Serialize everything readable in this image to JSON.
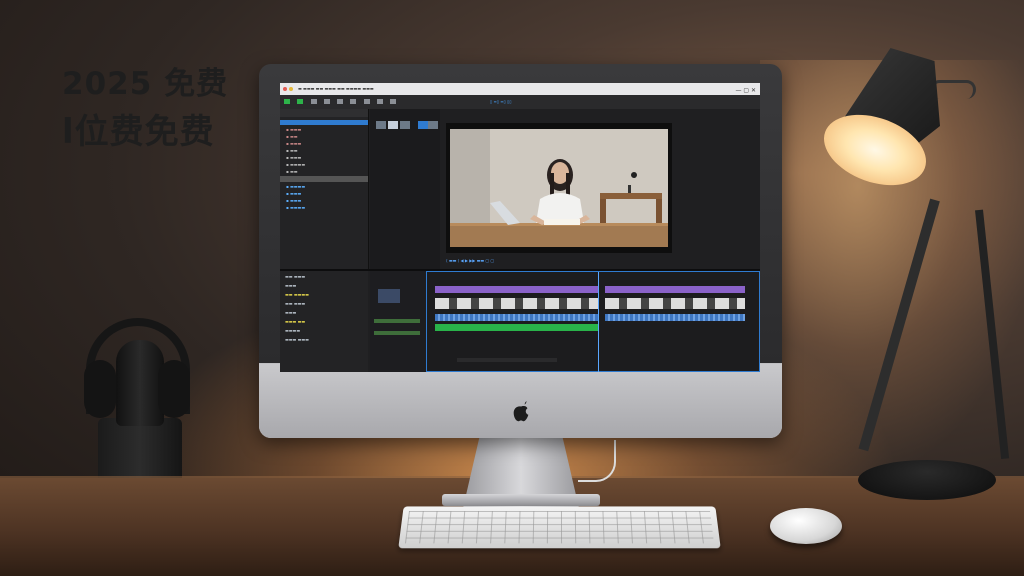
{
  "overlay_text": {
    "line1": "2025 免费",
    "line2": "l位费免费"
  },
  "editor": {
    "toolbar_label": "▯ ≡▯ ≡▯ ▯▯",
    "colors": {
      "accent_blue": "#2f7bd0",
      "audio_green": "#29b34a",
      "clip_purple": "#8a62c9",
      "audio_blue": "#3f77c2"
    }
  },
  "icons": {
    "apple_logo": "apple-logo-icon"
  }
}
